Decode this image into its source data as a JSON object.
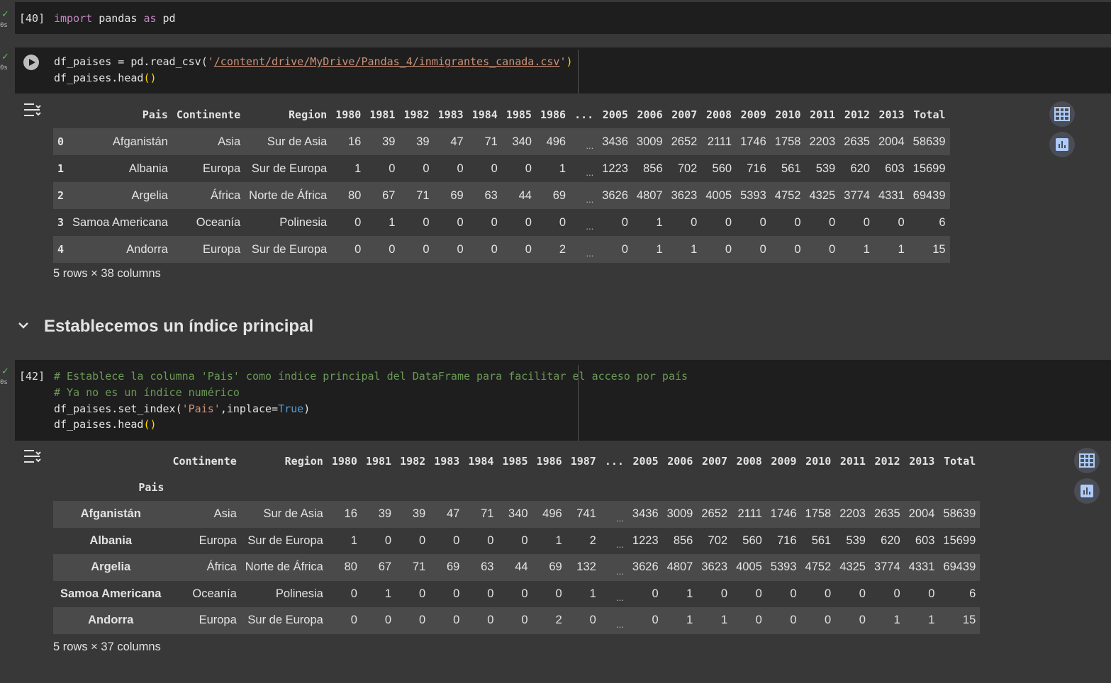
{
  "cells": {
    "c40": {
      "count": "[40]",
      "time": "0s",
      "line1_kw": "import",
      "line1_mod": " pandas ",
      "line1_as": "as",
      "line1_alias": " pd"
    },
    "c41": {
      "time": "0s",
      "line1_a": "df_paises = pd.read_csv(",
      "line1_q1": "'",
      "line1_path": "/content/drive/MyDrive/Pandas_4/inmigrantes_canada.csv",
      "line1_q2": "'",
      "line1_close": ")",
      "line2_a": "df_paises.head",
      "line2_paren": "()"
    },
    "c42": {
      "count": "[42]",
      "time": "0s",
      "line1": "# Establece la columna 'Pais' como índice principal del DataFrame para facilitar el acceso por país",
      "line2": "# Ya no es un índice numérico",
      "line3_a": "df_paises.set_index(",
      "line3_str": "'Pais'",
      "line3_b": ",inplace=",
      "line3_bool": "True",
      "line3_c": ")",
      "line4_a": "df_paises.head",
      "line4_paren": "()"
    }
  },
  "section": {
    "title": "Establecemos un índice principal"
  },
  "table1": {
    "columns": [
      "",
      "Pais",
      "Continente",
      "Region",
      "1980",
      "1981",
      "1982",
      "1983",
      "1984",
      "1985",
      "1986",
      "...",
      "2005",
      "2006",
      "2007",
      "2008",
      "2009",
      "2010",
      "2011",
      "2012",
      "2013",
      "Total"
    ],
    "rows": [
      [
        "0",
        "Afganistán",
        "Asia",
        "Sur de Asia",
        "16",
        "39",
        "39",
        "47",
        "71",
        "340",
        "496",
        "...",
        "3436",
        "3009",
        "2652",
        "2111",
        "1746",
        "1758",
        "2203",
        "2635",
        "2004",
        "58639"
      ],
      [
        "1",
        "Albania",
        "Europa",
        "Sur de Europa",
        "1",
        "0",
        "0",
        "0",
        "0",
        "0",
        "1",
        "...",
        "1223",
        "856",
        "702",
        "560",
        "716",
        "561",
        "539",
        "620",
        "603",
        "15699"
      ],
      [
        "2",
        "Argelia",
        "África",
        "Norte de África",
        "80",
        "67",
        "71",
        "69",
        "63",
        "44",
        "69",
        "...",
        "3626",
        "4807",
        "3623",
        "4005",
        "5393",
        "4752",
        "4325",
        "3774",
        "4331",
        "69439"
      ],
      [
        "3",
        "Samoa Americana",
        "Oceanía",
        "Polinesia",
        "0",
        "1",
        "0",
        "0",
        "0",
        "0",
        "0",
        "...",
        "0",
        "1",
        "0",
        "0",
        "0",
        "0",
        "0",
        "0",
        "0",
        "6"
      ],
      [
        "4",
        "Andorra",
        "Europa",
        "Sur de Europa",
        "0",
        "0",
        "0",
        "0",
        "0",
        "0",
        "2",
        "...",
        "0",
        "1",
        "1",
        "0",
        "0",
        "0",
        "0",
        "1",
        "1",
        "15"
      ]
    ],
    "shape": "5 rows × 38 columns"
  },
  "table2": {
    "columns": [
      "",
      "Continente",
      "Region",
      "1980",
      "1981",
      "1982",
      "1983",
      "1984",
      "1985",
      "1986",
      "1987",
      "...",
      "2005",
      "2006",
      "2007",
      "2008",
      "2009",
      "2010",
      "2011",
      "2012",
      "2013",
      "Total"
    ],
    "index_name": "Pais",
    "rows": [
      [
        "Afganistán",
        "Asia",
        "Sur de Asia",
        "16",
        "39",
        "39",
        "47",
        "71",
        "340",
        "496",
        "741",
        "...",
        "3436",
        "3009",
        "2652",
        "2111",
        "1746",
        "1758",
        "2203",
        "2635",
        "2004",
        "58639"
      ],
      [
        "Albania",
        "Europa",
        "Sur de Europa",
        "1",
        "0",
        "0",
        "0",
        "0",
        "0",
        "1",
        "2",
        "...",
        "1223",
        "856",
        "702",
        "560",
        "716",
        "561",
        "539",
        "620",
        "603",
        "15699"
      ],
      [
        "Argelia",
        "África",
        "Norte de África",
        "80",
        "67",
        "71",
        "69",
        "63",
        "44",
        "69",
        "132",
        "...",
        "3626",
        "4807",
        "3623",
        "4005",
        "5393",
        "4752",
        "4325",
        "3774",
        "4331",
        "69439"
      ],
      [
        "Samoa Americana",
        "Oceanía",
        "Polinesia",
        "0",
        "1",
        "0",
        "0",
        "0",
        "0",
        "0",
        "1",
        "...",
        "0",
        "1",
        "0",
        "0",
        "0",
        "0",
        "0",
        "0",
        "0",
        "6"
      ],
      [
        "Andorra",
        "Europa",
        "Sur de Europa",
        "0",
        "0",
        "0",
        "0",
        "0",
        "0",
        "2",
        "0",
        "...",
        "0",
        "1",
        "1",
        "0",
        "0",
        "0",
        "0",
        "1",
        "1",
        "15"
      ]
    ],
    "shape": "5 rows × 37 columns"
  }
}
